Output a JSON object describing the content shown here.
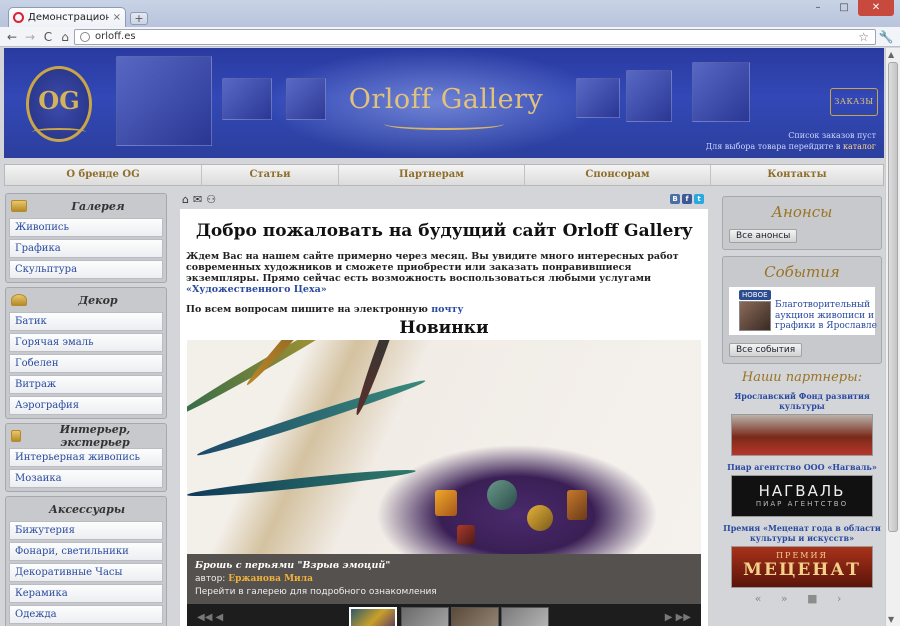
{
  "browser": {
    "tab_title": "Демонстрационный сайт г",
    "tab_close": "×",
    "new_tab": "+",
    "win_min": "–",
    "win_max": "□",
    "win_close": "✕",
    "back": "←",
    "forward": "→",
    "reload": "C",
    "home": "⌂",
    "url": "orloff.es",
    "star": "☆",
    "wrench": "🔧"
  },
  "header": {
    "logo_text": "OG",
    "title": "Orloff Gallery",
    "orders_button": "ЗАКАЗЫ",
    "orders_empty": "Список заказов пуст",
    "orders_hint": "Для выбора товара перейдите в",
    "orders_catalog": "каталог"
  },
  "topnav": [
    {
      "label": "О бренде OG"
    },
    {
      "label": "Статьи"
    },
    {
      "label": "Партнерам"
    },
    {
      "label": "Спонсорам"
    },
    {
      "label": "Контакты"
    }
  ],
  "left_menu": [
    {
      "title": "Галерея",
      "items": [
        "Живопись",
        "Графика",
        "Скульптура"
      ]
    },
    {
      "title": "Декор",
      "items": [
        "Батик",
        "Горячая эмаль",
        "Гобелен",
        "Витраж",
        "Аэрография"
      ]
    },
    {
      "title": "Интерьер, экстерьер",
      "items": [
        "Интерьерная живопись",
        "Мозаика"
      ]
    },
    {
      "title": "Аксессуары",
      "items": [
        "Бижутерия",
        "Фонари, светильники",
        "Декоративные Часы",
        "Керамика",
        "Одежда"
      ]
    }
  ],
  "tools": {
    "home": "⌂",
    "mail": "✉",
    "sitemap": "⚇"
  },
  "social": {
    "vk": "B",
    "fb": "f",
    "tw": "t"
  },
  "content": {
    "welcome": "Добро пожаловать на будущий сайт Orloff Gallery",
    "lead": "Ждем Вас на нашем сайте примерно через месяц. Вы увидите много интересных работ современных художников и сможете приобрести или заказать понравившиеся экземпляры. Прямо сейчас есть возможность воспользоваться любыми услугами",
    "lead_link": "«Художественного Цеха»",
    "mail_text": "По всем вопросам пишите на электронную",
    "mail_link": "почту",
    "new_heading": "Новинки"
  },
  "slide": {
    "title": "Брошь с перьями \"Взрыв эмоций\"",
    "author_label": "автор:",
    "author_name": "Ержанова Мила",
    "link_text": "Перейти в галерею для подробного ознакомления",
    "nav_prev": "◀◀ ◀",
    "nav_next": "▶ ▶▶"
  },
  "right": {
    "announcements_title": "Анонсы",
    "all_announcements": "Все анонсы",
    "events_title": "События",
    "event_badge": "НОВОЕ",
    "event_text": "Благотворительный аукцион живописи и графики в Ярославле",
    "all_events": "Все события",
    "partners_title": "Наши партнеры:",
    "partners": [
      {
        "name": "Ярославский Фонд развития культуры"
      },
      {
        "name": "Пиар агентство ООО «Нагваль»",
        "logo_text": "НАГВАЛЬ",
        "logo_sub": "ПИАР АГЕНТСТВО"
      },
      {
        "name": "Премия «Меценат года в области культуры и искусств»",
        "logo_top": "ПРЕМИЯ",
        "logo_text": "МЕЦЕНАТ"
      }
    ],
    "pager": "« » ■ ›"
  }
}
